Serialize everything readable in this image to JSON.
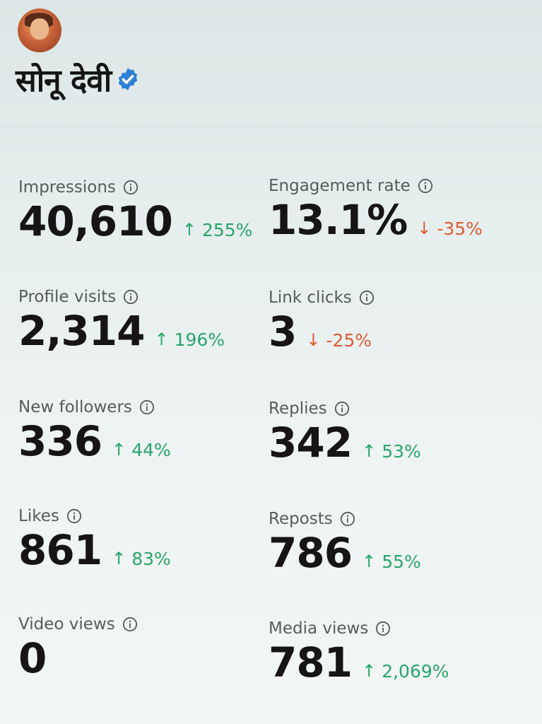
{
  "profile": {
    "name": "सोनू देवी",
    "verified_icon": "verified-badge-icon",
    "accent_color": "#2f7fd6"
  },
  "metrics": [
    {
      "label": "Impressions",
      "value": "40,610",
      "change": "255%",
      "direction": "up"
    },
    {
      "label": "Engagement rate",
      "value": "13.1%",
      "change": "-35%",
      "direction": "down"
    },
    {
      "label": "Profile visits",
      "value": "2,314",
      "change": "196%",
      "direction": "up"
    },
    {
      "label": "Link clicks",
      "value": "3",
      "change": "-25%",
      "direction": "down"
    },
    {
      "label": "New followers",
      "value": "336",
      "change": "44%",
      "direction": "up"
    },
    {
      "label": "Replies",
      "value": "342",
      "change": "53%",
      "direction": "up"
    },
    {
      "label": "Likes",
      "value": "861",
      "change": "83%",
      "direction": "up"
    },
    {
      "label": "Reposts",
      "value": "786",
      "change": "55%",
      "direction": "up"
    },
    {
      "label": "Video views",
      "value": "0",
      "change": "",
      "direction": "none"
    },
    {
      "label": "Media views",
      "value": "781",
      "change": "2,069%",
      "direction": "up"
    }
  ],
  "arrows": {
    "up": "↑",
    "down": "↓"
  },
  "colors": {
    "up": "#2aa56a",
    "down": "#e05a32"
  }
}
